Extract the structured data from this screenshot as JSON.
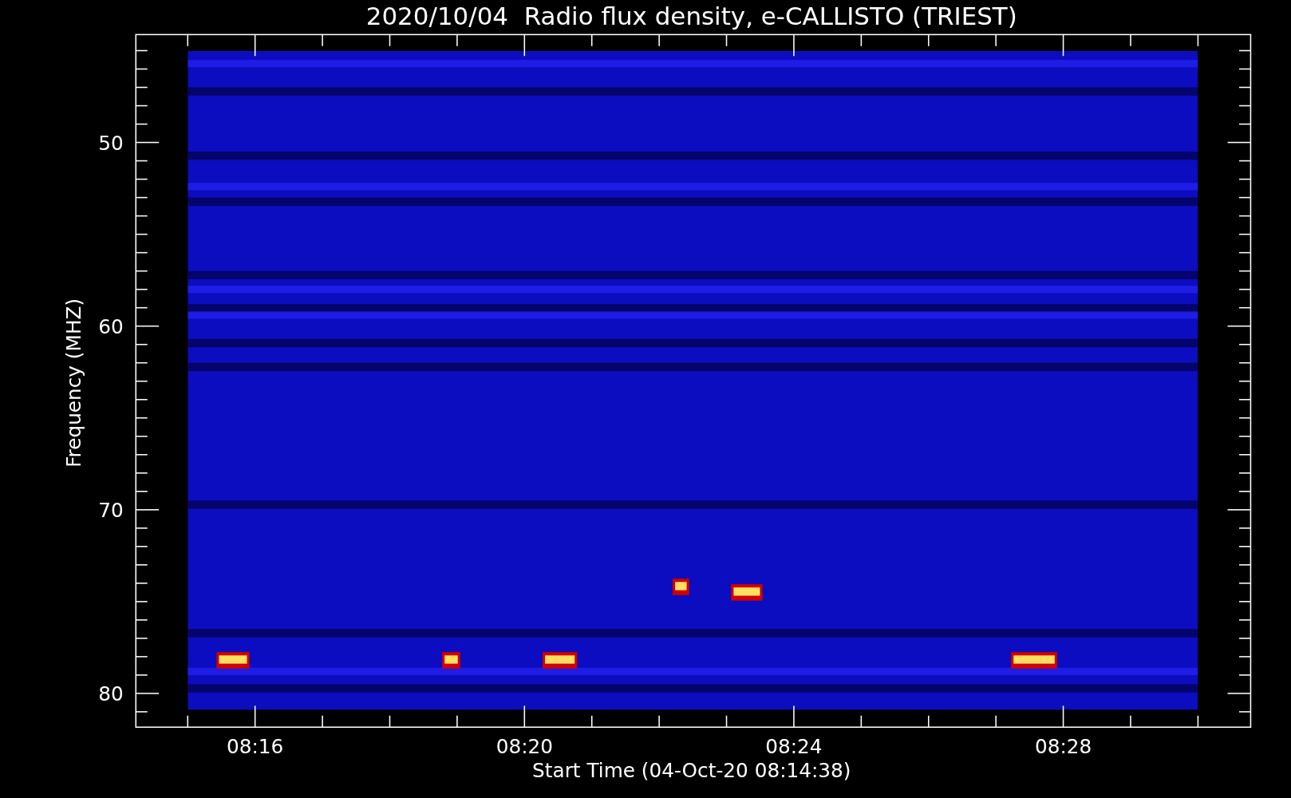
{
  "title": "2020/10/04  Radio flux density, e-CALLISTO (TRIEST)",
  "xlabel": "Start Time (04-Oct-20 08:14:38)",
  "ylabel": "Frequency (MHZ)",
  "yticks": [
    "50",
    "60",
    "70",
    "80"
  ],
  "xticks": [
    "08:16",
    "08:20",
    "08:24",
    "08:28"
  ]
}
